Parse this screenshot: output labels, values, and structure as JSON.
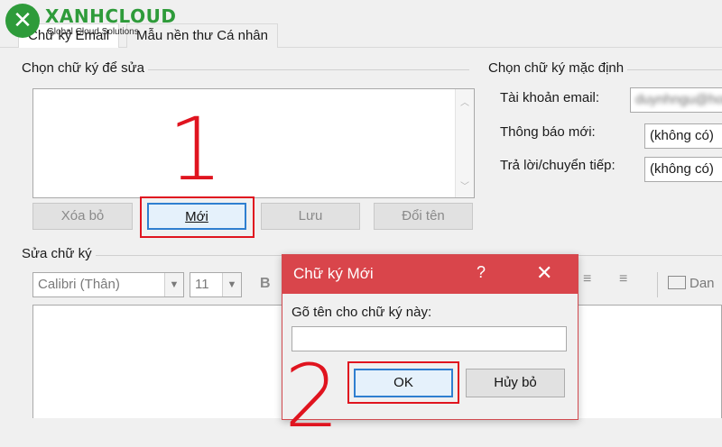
{
  "logo": {
    "icon": "x-logo-icon",
    "brand": "XANHCLOUD",
    "tagline": "Global Cloud Solutions"
  },
  "tabs": [
    {
      "label": "Chữ ký Email"
    },
    {
      "label": "Mẫu nền thư Cá nhân"
    }
  ],
  "select_sig": {
    "title": "Chọn chữ ký để sửa",
    "buttons": {
      "delete": "Xóa bỏ",
      "new": "Mới",
      "save": "Lưu",
      "rename": "Đổi tên"
    }
  },
  "default_sig": {
    "title": "Chọn chữ ký mặc định",
    "email_label": "Tài khoản email:",
    "email_value": "duynhngu@hotmail.com",
    "new_label": "Thông báo mới:",
    "new_value": "(không có)",
    "reply_label": "Trả lời/chuyển tiếp:",
    "reply_value": "(không có)"
  },
  "edit_sig": {
    "title": "Sửa chữ ký",
    "font": "Calibri (Thân)",
    "size": "11",
    "bold": "B",
    "card_label": "Dan"
  },
  "steps": {
    "one": "1",
    "two": "2"
  },
  "dialog": {
    "title": "Chữ ký Mới",
    "help": "?",
    "close": "✕",
    "prompt": "Gõ tên cho chữ ký này:",
    "input_value": "",
    "ok": "OK",
    "cancel": "Hủy bỏ"
  },
  "colors": {
    "accent_red": "#e0141f",
    "dialog_title": "#d9454b",
    "focus_blue": "#2f7fd0",
    "brand_green": "#2e9b3a"
  }
}
